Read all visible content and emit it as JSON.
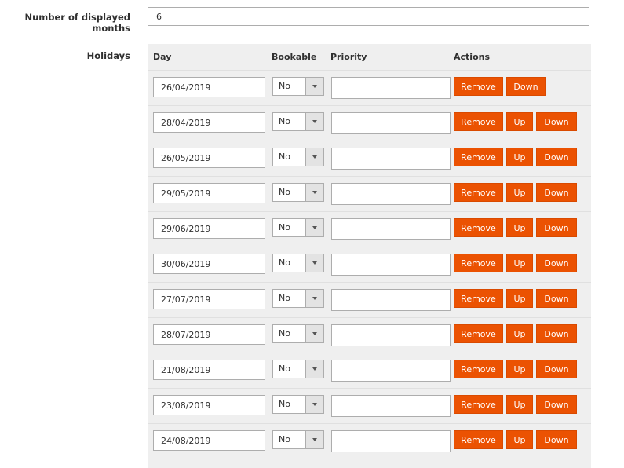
{
  "settings": {
    "months_label": "Number of displayed months",
    "months_value": "6",
    "holidays_label": "Holidays"
  },
  "holidays": {
    "headers": {
      "day": "Day",
      "bookable": "Bookable",
      "priority": "Priority",
      "actions": "Actions"
    },
    "buttons": {
      "remove": "Remove",
      "up": "Up",
      "down": "Down"
    },
    "rows": [
      {
        "day": "26/04/2019",
        "bookable": "No",
        "priority": ""
      },
      {
        "day": "28/04/2019",
        "bookable": "No",
        "priority": ""
      },
      {
        "day": "26/05/2019",
        "bookable": "No",
        "priority": ""
      },
      {
        "day": "29/05/2019",
        "bookable": "No",
        "priority": ""
      },
      {
        "day": "29/06/2019",
        "bookable": "No",
        "priority": ""
      },
      {
        "day": "30/06/2019",
        "bookable": "No",
        "priority": ""
      },
      {
        "day": "27/07/2019",
        "bookable": "No",
        "priority": ""
      },
      {
        "day": "28/07/2019",
        "bookable": "No",
        "priority": ""
      },
      {
        "day": "21/08/2019",
        "bookable": "No",
        "priority": ""
      },
      {
        "day": "23/08/2019",
        "bookable": "No",
        "priority": ""
      },
      {
        "day": "24/08/2019",
        "bookable": "No",
        "priority": ""
      }
    ]
  },
  "colors": {
    "accent": "#eb5202",
    "grid_background": "#efefef"
  },
  "icons": {
    "select_arrow": "chevron-down-icon"
  }
}
